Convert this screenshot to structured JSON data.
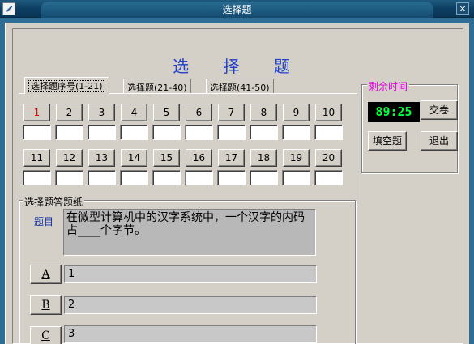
{
  "window": {
    "title": "选择题",
    "close_glyph": "×"
  },
  "heading": "选 择 题",
  "tabs": [
    {
      "label": "选择题序号(1-21)",
      "active": true
    },
    {
      "label": "选择题(21-40)",
      "active": false
    },
    {
      "label": "选择题(41-50)",
      "active": false
    }
  ],
  "question_numbers": {
    "row1": [
      "1",
      "2",
      "3",
      "4",
      "5",
      "6",
      "7",
      "8",
      "9",
      "10"
    ],
    "row2": [
      "11",
      "12",
      "13",
      "14",
      "15",
      "16",
      "17",
      "18",
      "19",
      "20"
    ],
    "current": "1",
    "current_color": "#e00000"
  },
  "timer": {
    "legend": "剩余时间",
    "legend_color": "#e000e0",
    "value": "89:25",
    "value_color": "#00ff40"
  },
  "buttons": {
    "submit": "交卷",
    "fill_blank": "填空题",
    "exit": "退出"
  },
  "answer_sheet": {
    "legend": "选择题答题纸",
    "question_label": "题目",
    "question_text": "在微型计算机中的汉字系统中，一个汉字的内码占____个字节。",
    "options": [
      {
        "key": "A",
        "text": "1"
      },
      {
        "key": "B",
        "text": "2"
      },
      {
        "key": "C",
        "text": "3"
      }
    ]
  },
  "icons": {
    "app": "pen-icon",
    "close": "close-icon"
  }
}
